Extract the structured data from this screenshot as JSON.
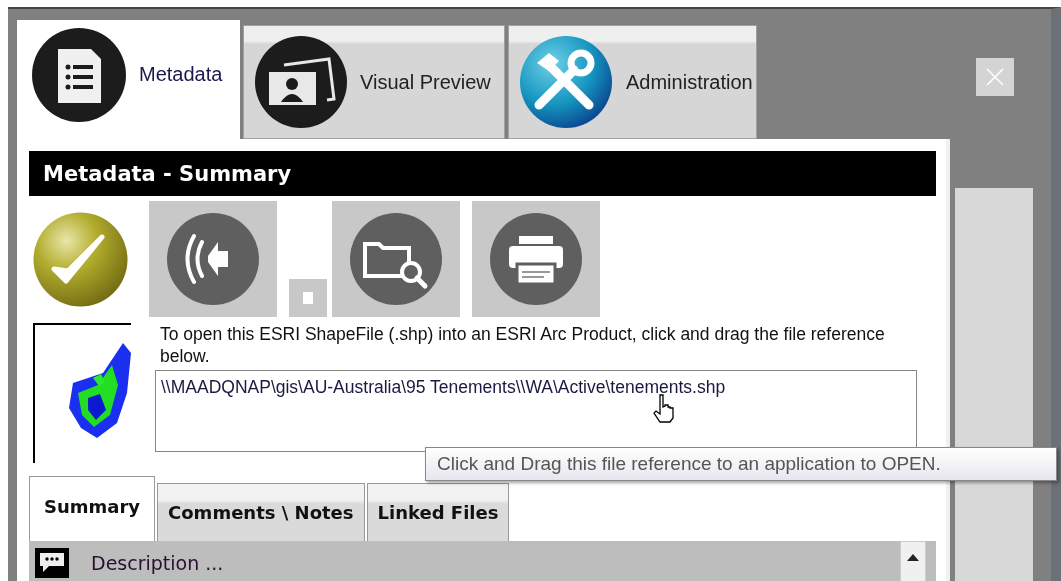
{
  "main_tabs": [
    {
      "label": "Metadata",
      "kind": "document",
      "selected": true
    },
    {
      "label": "Visual Preview",
      "kind": "photos",
      "selected": false
    },
    {
      "label": "Administration",
      "kind": "tools",
      "selected": false
    }
  ],
  "panel_title": "Metadata - Summary",
  "status": {
    "kind": "check"
  },
  "toolbar": [
    {
      "kind": "sound"
    },
    {
      "kind": "small"
    },
    {
      "kind": "folder-search"
    },
    {
      "kind": "print"
    }
  ],
  "instruction": "To open this ESRI ShapeFile (.shp) into an ESRI Arc Product, click and drag the file reference below.",
  "file_reference": "\\\\MAADQNAP\\gis\\AU-Australia\\95 Tenements\\\\WA\\Active\\tenements.shp",
  "tooltip": "Click and Drag this file reference to an application to OPEN.",
  "sub_tabs": [
    {
      "label": "Summary",
      "selected": true
    },
    {
      "label": "Comments \\ Notes",
      "selected": false
    },
    {
      "label": "Linked Files",
      "selected": false
    }
  ],
  "sections": [
    {
      "label": "Description ..."
    }
  ]
}
